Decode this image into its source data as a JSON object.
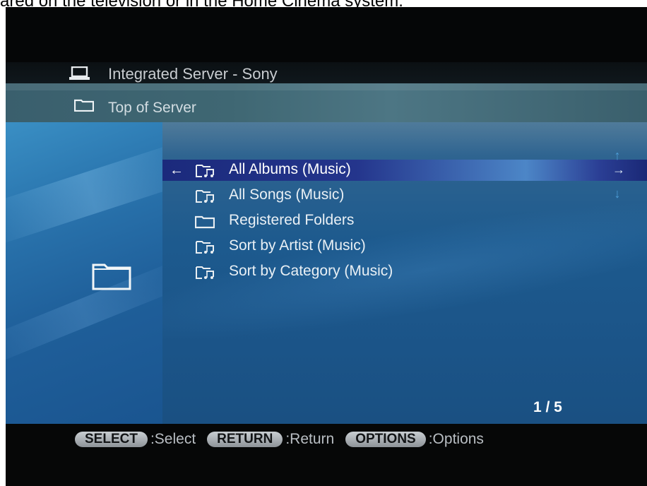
{
  "caption": "ared on the television or in the Home Cinema system.",
  "header": {
    "server_name": "Integrated Server - Sony",
    "server_icon": "laptop-icon",
    "location": "Top of Server",
    "location_icon": "folder-icon"
  },
  "list": {
    "items": [
      {
        "label": "All Albums (Music)",
        "icon": "music-folder-icon",
        "selected": true
      },
      {
        "label": "All Songs (Music)",
        "icon": "music-folder-icon",
        "selected": false
      },
      {
        "label": "Registered Folders",
        "icon": "folder-icon",
        "selected": false
      },
      {
        "label": "Sort by Artist (Music)",
        "icon": "music-folder-icon",
        "selected": false
      },
      {
        "label": "Sort by Category (Music)",
        "icon": "music-folder-icon",
        "selected": false
      }
    ],
    "page": "1 / 5"
  },
  "hints": [
    {
      "button": "SELECT",
      "text": ":Select"
    },
    {
      "button": "RETURN",
      "text": ":Return"
    },
    {
      "button": "OPTIONS",
      "text": ":Options"
    }
  ],
  "colors": {
    "highlight": "#24358c",
    "panel": "#1d5a8e",
    "header_band": "#3f6773",
    "background": "#050607"
  }
}
